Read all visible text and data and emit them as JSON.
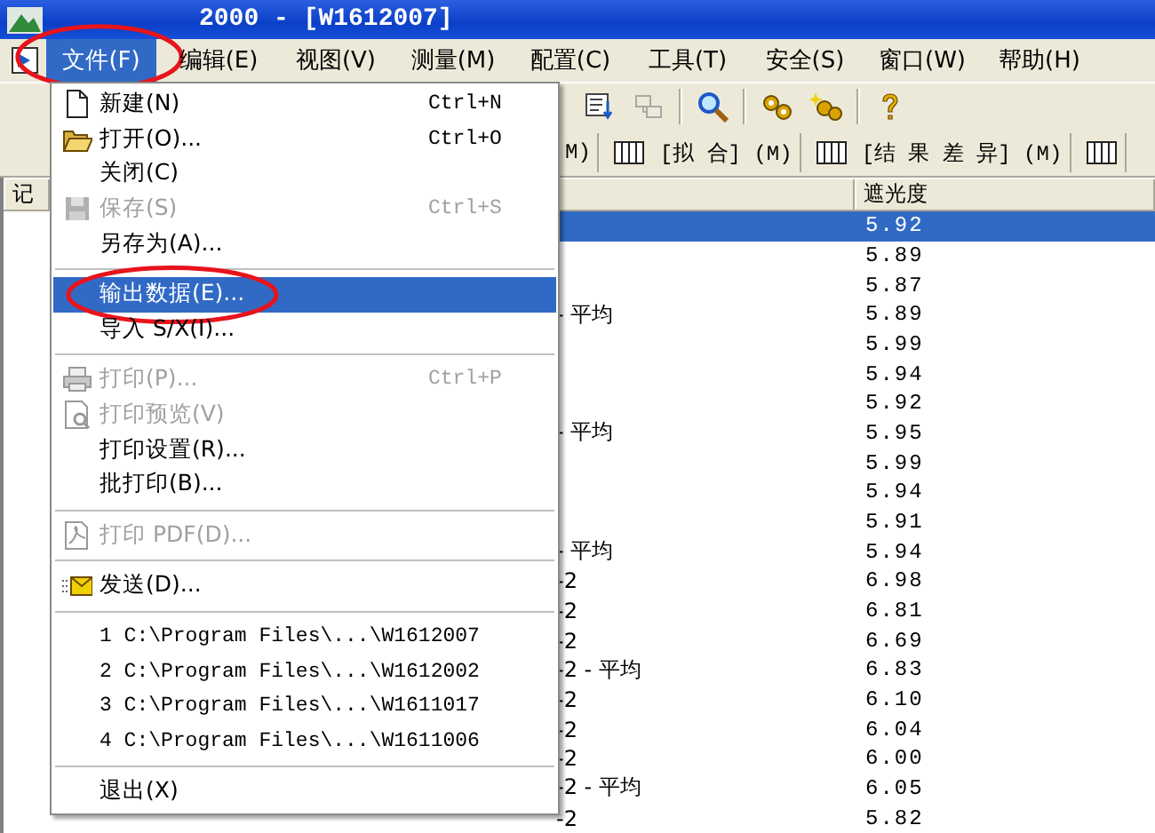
{
  "window": {
    "title": "2000 - [W1612007]"
  },
  "menubar": [
    {
      "label": "文件(F)",
      "selected": true,
      "circled": true
    },
    {
      "label": "编辑(E)",
      "selected": false,
      "circled": false
    },
    {
      "label": "视图(V)",
      "selected": false,
      "circled": false
    },
    {
      "label": "测量(M)",
      "selected": false,
      "circled": false
    },
    {
      "label": "配置(C)",
      "selected": false,
      "circled": false
    },
    {
      "label": "工具(T)",
      "selected": false,
      "circled": false
    },
    {
      "label": "安全(S)",
      "selected": false,
      "circled": false
    },
    {
      "label": "窗口(W)",
      "selected": false,
      "circled": false
    },
    {
      "label": "帮助(H)",
      "selected": false,
      "circled": false
    }
  ],
  "toolbar": [
    {
      "disabled": false
    },
    {
      "disabled": true
    },
    {
      "disabled": false
    },
    {
      "disabled": false
    },
    {
      "disabled": false
    },
    {
      "disabled": false
    }
  ],
  "view_tabs": [
    {
      "kind": "text",
      "label": "M)"
    },
    {
      "kind": "icon_text",
      "label": "[拟 合] (M)"
    },
    {
      "kind": "icon_text",
      "label": "[结 果 差 异] (M)"
    },
    {
      "kind": "icon"
    }
  ],
  "table": {
    "columns": [
      "记",
      "遮光度"
    ],
    "rows": [
      {
        "value": "5.92",
        "selected": true
      },
      {
        "value": "5.89",
        "selected": false
      },
      {
        "value": "5.87",
        "selected": false
      },
      {
        "column_2": "- 平均",
        "value": "5.89",
        "selected": false
      },
      {
        "value": "5.99",
        "selected": false
      },
      {
        "value": "5.94",
        "selected": false
      },
      {
        "value": "5.92",
        "selected": false
      },
      {
        "column_2": "- 平均",
        "value": "5.95",
        "selected": false
      },
      {
        "value": "5.99",
        "selected": false
      },
      {
        "value": "5.94",
        "selected": false
      },
      {
        "value": "5.91",
        "selected": false
      },
      {
        "column_2": "- 平均",
        "value": "5.94",
        "selected": false
      },
      {
        "column_2": "-2",
        "value": "6.98",
        "selected": false
      },
      {
        "column_2": "-2",
        "value": "6.81",
        "selected": false
      },
      {
        "column_2": "-2",
        "value": "6.69",
        "selected": false
      },
      {
        "column_2": "-2 - 平均",
        "value": "6.83",
        "selected": false
      },
      {
        "column_2": "-2",
        "value": "6.10",
        "selected": false
      },
      {
        "column_2": "-2",
        "value": "6.04",
        "selected": false
      },
      {
        "column_2": "-2",
        "value": "6.00",
        "selected": false
      },
      {
        "column_2": "-2 - 平均",
        "value": "6.05",
        "selected": false
      },
      {
        "column_2": "-2",
        "value": "5.82",
        "selected": false
      }
    ]
  },
  "file_menu": [
    {
      "kind": "item",
      "label": "新建(N)",
      "shortcut": "Ctrl+N",
      "disabled": false,
      "selected": false,
      "circled": false
    },
    {
      "kind": "item",
      "label": "打开(O)...",
      "shortcut": "Ctrl+O",
      "disabled": false,
      "selected": false,
      "circled": false
    },
    {
      "kind": "item",
      "label": "关闭(C)",
      "disabled": false,
      "selected": false,
      "circled": false
    },
    {
      "kind": "item",
      "label": "保存(S)",
      "shortcut": "Ctrl+S",
      "disabled": true,
      "selected": false,
      "circled": false
    },
    {
      "kind": "item",
      "label": "另存为(A)...",
      "disabled": false,
      "selected": false,
      "circled": false
    },
    {
      "kind": "separator"
    },
    {
      "kind": "item",
      "label": "输出数据(E)...",
      "disabled": false,
      "selected": true,
      "circled": true
    },
    {
      "kind": "item",
      "label": "导入 S/X(I)...",
      "disabled": false,
      "selected": false,
      "circled": false
    },
    {
      "kind": "separator"
    },
    {
      "kind": "item",
      "label": "打印(P)...",
      "shortcut": "Ctrl+P",
      "disabled": true,
      "selected": false,
      "circled": false
    },
    {
      "kind": "item",
      "label": "打印预览(V)",
      "disabled": true,
      "selected": false,
      "circled": false
    },
    {
      "kind": "item",
      "label": "打印设置(R)...",
      "disabled": false,
      "selected": false,
      "circled": false
    },
    {
      "kind": "item",
      "label": "批打印(B)...",
      "disabled": false,
      "selected": false,
      "circled": false
    },
    {
      "kind": "separator"
    },
    {
      "kind": "item",
      "label": "打印 PDF(D)...",
      "disabled": true,
      "selected": false,
      "circled": false
    },
    {
      "kind": "separator"
    },
    {
      "kind": "item",
      "label": "发送(D)...",
      "disabled": false,
      "selected": false,
      "circled": false
    },
    {
      "kind": "separator"
    },
    {
      "kind": "item",
      "label": "1 C:\\Program Files\\...\\W1612007",
      "disabled": false,
      "selected": false,
      "circled": false
    },
    {
      "kind": "item",
      "label": "2 C:\\Program Files\\...\\W1612002",
      "disabled": false,
      "selected": false,
      "circled": false
    },
    {
      "kind": "item",
      "label": "3 C:\\Program Files\\...\\W1611017",
      "disabled": false,
      "selected": false,
      "circled": false
    },
    {
      "kind": "item",
      "label": "4 C:\\Program Files\\...\\W1611006",
      "disabled": false,
      "selected": false,
      "circled": false
    },
    {
      "kind": "separator"
    },
    {
      "kind": "item",
      "label": "退出(X)",
      "disabled": false,
      "selected": false,
      "circled": false
    }
  ]
}
